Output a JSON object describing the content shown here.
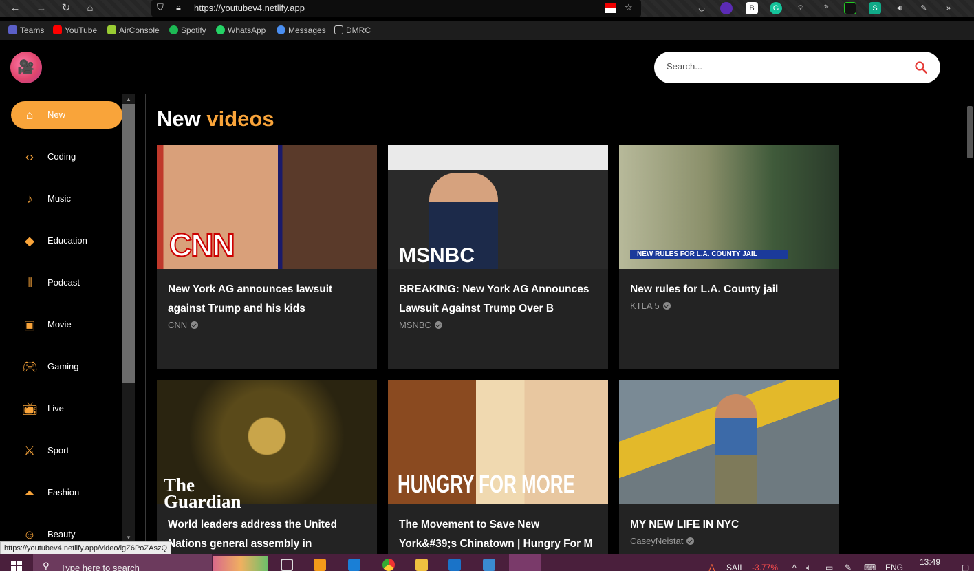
{
  "browser": {
    "url": "https://youtubev4.netlify.app",
    "bookmarks": [
      "Teams",
      "YouTube",
      "AirConsole",
      "Spotify",
      "WhatsApp",
      "Messages",
      "DMRC"
    ]
  },
  "search": {
    "placeholder": "Search..."
  },
  "sidebar": {
    "items": [
      {
        "label": "New",
        "icon": "home-icon",
        "active": true
      },
      {
        "label": "Coding",
        "icon": "code-icon"
      },
      {
        "label": "Music",
        "icon": "music-note-icon"
      },
      {
        "label": "Education",
        "icon": "graduation-cap-icon"
      },
      {
        "label": "Podcast",
        "icon": "audio-wave-icon"
      },
      {
        "label": "Movie",
        "icon": "play-screen-icon"
      },
      {
        "label": "Gaming",
        "icon": "gamepad-icon"
      },
      {
        "label": "Live",
        "icon": "tv-icon"
      },
      {
        "label": "Sport",
        "icon": "sport-icon"
      },
      {
        "label": "Fashion",
        "icon": "hanger-icon"
      },
      {
        "label": "Beauty",
        "icon": "face-icon"
      }
    ]
  },
  "main": {
    "heading_main": "New",
    "heading_accent": "videos",
    "videos": [
      {
        "title": "New York AG announces lawsuit against Trump and his kids",
        "channel": "CNN",
        "thumb_text": "CNN"
      },
      {
        "title": "BREAKING: New York AG Announces Lawsuit Against Trump Over B",
        "channel": "MSNBC",
        "thumb_text": "MSNBC"
      },
      {
        "title": "New rules for L.A. County jail",
        "channel": "KTLA 5",
        "thumb_text": "NEW RULES FOR L.A. COUNTY JAIL"
      },
      {
        "title": "World leaders address the United Nations general assembly in",
        "channel": "",
        "thumb_text": "The Guardian"
      },
      {
        "title": "The Movement to Save New York&#39;s Chinatown | Hungry For M",
        "channel": "",
        "thumb_text": "HUNGRY FOR MORE"
      },
      {
        "title": "MY NEW LIFE IN NYC",
        "channel": "CaseyNeistat",
        "thumb_text": ""
      }
    ]
  },
  "status_url": "https://youtubev4.netlify.app/video/igZ6PoZAszQ",
  "taskbar": {
    "search_placeholder": "Type here to search",
    "stock": "SAIL",
    "stock_change": "-3.77%",
    "language": "ENG",
    "time": "13:49"
  },
  "colors": {
    "accent": "#f9a43a",
    "card_bg": "#232323",
    "stock_down": "#ff4d4d"
  }
}
